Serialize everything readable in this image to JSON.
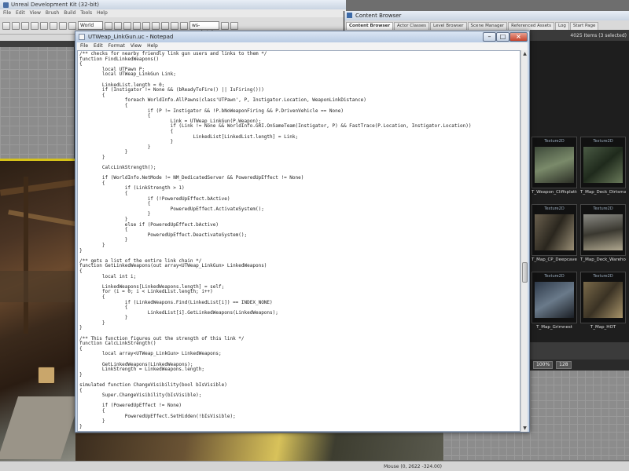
{
  "editor": {
    "title": "Unreal Development Kit (32-bit)",
    "menu": [
      "File",
      "Edit",
      "View",
      "Brush",
      "Build",
      "Tools",
      "Help"
    ],
    "toolbar_combo_1": "World",
    "toolbar_combo_2": "ws-marketplace",
    "statusbar_text": "Mouse (0, 2622 -324.00)"
  },
  "content_browser": {
    "title": "Content Browser",
    "tabs": [
      "Content Browser",
      "Actor Classes",
      "Level Browser",
      "Scene Manager",
      "Referenced Assets",
      "Log",
      "Start Page"
    ],
    "asset_count": "4025 Items (3 selected)",
    "assets": [
      {
        "type": "Texture2D",
        "label": "T_Weapon_Cliffsplatter"
      },
      {
        "type": "Texture2D",
        "label": "T_Map_Deck_Dirtsmall"
      },
      {
        "type": "Texture2D",
        "label": "T_Map_CP_Deepcaves"
      },
      {
        "type": "Texture2D",
        "label": "T_Map_Deck_Warehouse"
      },
      {
        "type": "Texture2D",
        "label": "T_Map_Grimnest"
      },
      {
        "type": "Texture2D",
        "label": "T_Map_HOT"
      }
    ],
    "zoom_1": "100%",
    "zoom_2": "128"
  },
  "notepad": {
    "title": "UTWeap_LinkGun.uc - Notepad",
    "menu": [
      "File",
      "Edit",
      "Format",
      "View",
      "Help"
    ],
    "code_lines": [
      "/** checks for nearby friendly link gun users and links to them */",
      "function FindLinkedWeapons()",
      "{",
      "        local UTPawn P;",
      "        local UTWeap_LinkGun Link;",
      "",
      "        LinkedList.length = 0;",
      "        if (Instigator != None && (bReadyToFire() || IsFiring()))",
      "        {",
      "                foreach WorldInfo.AllPawns(class'UTPawn', P, Instigator.Location, WeaponLinkDistance)",
      "                {",
      "                        if (P != Instigator && !P.bNoWeaponFiring && P.DrivenVehicle == None)",
      "                        {",
      "                                Link = UTWeap_LinkGun(P.Weapon);",
      "                                if (Link != None && WorldInfo.GRI.OnSameTeam(Instigator, P) && FastTrace(P.Location, Instigator.Location))",
      "                                {",
      "                                        LinkedList[LinkedList.length] = Link;",
      "                                }",
      "                        }",
      "                }",
      "        }",
      "",
      "        CalcLinkStrength();",
      "",
      "        if (WorldInfo.NetMode != NM_DedicatedServer && PoweredUpEffect != None)",
      "        {",
      "                if (LinkStrength > 1)",
      "                {",
      "                        if (!PoweredUpEffect.bActive)",
      "                        {",
      "                                PoweredUpEffect.ActivateSystem();",
      "                        }",
      "                }",
      "                else if (PoweredUpEffect.bActive)",
      "                {",
      "                        PoweredUpEffect.DeactivateSystem();",
      "                }",
      "        }",
      "}",
      "",
      "/** gets a list of the entire link chain */",
      "function GetLinkedWeapons(out array<UTWeap_LinkGun> LinkedWeapons)",
      "{",
      "        local int i;",
      "",
      "        LinkedWeapons[LinkedWeapons.length] = self;",
      "        for (i = 0; i < LinkedList.length; i++)",
      "        {",
      "                if (LinkedWeapons.Find(LinkedList[i]) == INDEX_NONE)",
      "                {",
      "                        LinkedList[i].GetLinkedWeapons(LinkedWeapons);",
      "                }",
      "        }",
      "}",
      "",
      "/** This function figures out the strength of this link */",
      "function CalcLinkStrength()",
      "{",
      "        local array<UTWeap_LinkGun> LinkedWeapons;",
      "",
      "        GetLinkedWeapons(LinkedWeapons);",
      "        LinkStrength = LinkedWeapons.length;",
      "}",
      "",
      "simulated function ChangeVisibility(bool bIsVisible)",
      "{",
      "        Super.ChangeVisibility(bIsVisible);",
      "",
      "        if (PoweredUpEffect != None)",
      "        {",
      "                PoweredUpEffect.SetHidden(!bIsVisible);",
      "        }",
      "}"
    ]
  }
}
